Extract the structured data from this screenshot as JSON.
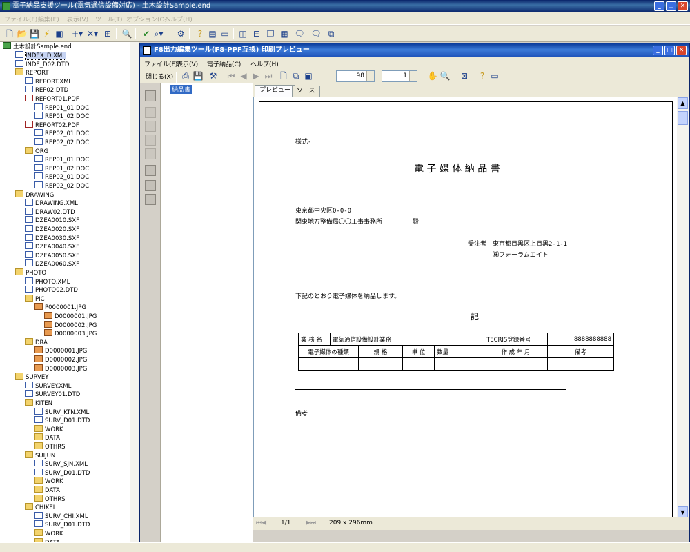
{
  "app": {
    "title": "電子納品支援ツール(電気通信設備対応) - 土木設計Sample.end",
    "menu": [
      "ファイル(F)",
      "編集(E)",
      "表示(V)",
      "ツール(T)",
      "オプション(O)",
      "ヘルプ(H)"
    ]
  },
  "tree": {
    "root": "土木設計Sample.end",
    "nodes": [
      {
        "label": "INDEX_D.XML",
        "type": "file",
        "level": 1,
        "selected": true
      },
      {
        "label": "INDE_D02.DTD",
        "type": "file",
        "level": 1
      },
      {
        "label": "REPORT",
        "type": "folder",
        "level": 1
      },
      {
        "label": "REPORT.XML",
        "type": "file",
        "level": 2
      },
      {
        "label": "REP02.DTD",
        "type": "file",
        "level": 2
      },
      {
        "label": "REPORT01.PDF",
        "type": "pdf",
        "level": 2
      },
      {
        "label": "REP01_01.DOC",
        "type": "file",
        "level": 3
      },
      {
        "label": "REP01_02.DOC",
        "type": "file",
        "level": 3
      },
      {
        "label": "REPORT02.PDF",
        "type": "pdf",
        "level": 2
      },
      {
        "label": "REP02_01.DOC",
        "type": "file",
        "level": 3
      },
      {
        "label": "REP02_02.DOC",
        "type": "file",
        "level": 3
      },
      {
        "label": "ORG",
        "type": "folder",
        "level": 2
      },
      {
        "label": "REP01_01.DOC",
        "type": "file",
        "level": 3
      },
      {
        "label": "REP01_02.DOC",
        "type": "file",
        "level": 3
      },
      {
        "label": "REP02_01.DOC",
        "type": "file",
        "level": 3
      },
      {
        "label": "REP02_02.DOC",
        "type": "file",
        "level": 3
      },
      {
        "label": "DRAWING",
        "type": "folder",
        "level": 1
      },
      {
        "label": "DRAWING.XML",
        "type": "file",
        "level": 2
      },
      {
        "label": "DRAW02.DTD",
        "type": "file",
        "level": 2
      },
      {
        "label": "DZEA0010.SXF",
        "type": "file",
        "level": 2
      },
      {
        "label": "DZEA0020.SXF",
        "type": "file",
        "level": 2
      },
      {
        "label": "DZEA0030.SXF",
        "type": "file",
        "level": 2
      },
      {
        "label": "DZEA0040.SXF",
        "type": "file",
        "level": 2
      },
      {
        "label": "DZEA0050.SXF",
        "type": "file",
        "level": 2
      },
      {
        "label": "DZEA0060.SXF",
        "type": "file",
        "level": 2
      },
      {
        "label": "PHOTO",
        "type": "folder",
        "level": 1
      },
      {
        "label": "PHOTO.XML",
        "type": "file",
        "level": 2
      },
      {
        "label": "PHOTO02.DTD",
        "type": "file",
        "level": 2
      },
      {
        "label": "PIC",
        "type": "folder",
        "level": 2
      },
      {
        "label": "P0000001.JPG",
        "type": "img",
        "level": 3
      },
      {
        "label": "D0000001.JPG",
        "type": "img",
        "level": 4
      },
      {
        "label": "D0000002.JPG",
        "type": "img",
        "level": 4
      },
      {
        "label": "D0000003.JPG",
        "type": "img",
        "level": 4
      },
      {
        "label": "DRA",
        "type": "folder",
        "level": 2
      },
      {
        "label": "D0000001.JPG",
        "type": "img",
        "level": 3
      },
      {
        "label": "D0000002.JPG",
        "type": "img",
        "level": 3
      },
      {
        "label": "D0000003.JPG",
        "type": "img",
        "level": 3
      },
      {
        "label": "SURVEY",
        "type": "folder",
        "level": 1
      },
      {
        "label": "SURVEY.XML",
        "type": "file",
        "level": 2
      },
      {
        "label": "SURVEY01.DTD",
        "type": "file",
        "level": 2
      },
      {
        "label": "KITEN",
        "type": "folder",
        "level": 2
      },
      {
        "label": "SURV_KTN.XML",
        "type": "file",
        "level": 3
      },
      {
        "label": "SURV_D01.DTD",
        "type": "file",
        "level": 3
      },
      {
        "label": "WORK",
        "type": "folder",
        "level": 3
      },
      {
        "label": "DATA",
        "type": "folder",
        "level": 3
      },
      {
        "label": "OTHRS",
        "type": "folder",
        "level": 3
      },
      {
        "label": "SUIJUN",
        "type": "folder",
        "level": 2
      },
      {
        "label": "SURV_SJN.XML",
        "type": "file",
        "level": 3
      },
      {
        "label": "SURV_D01.DTD",
        "type": "file",
        "level": 3
      },
      {
        "label": "WORK",
        "type": "folder",
        "level": 3
      },
      {
        "label": "DATA",
        "type": "folder",
        "level": 3
      },
      {
        "label": "OTHRS",
        "type": "folder",
        "level": 3
      },
      {
        "label": "CHIKEI",
        "type": "folder",
        "level": 2
      },
      {
        "label": "SURV_CHI.XML",
        "type": "file",
        "level": 3
      },
      {
        "label": "SURV_D01.DTD",
        "type": "file",
        "level": 3
      },
      {
        "label": "WORK",
        "type": "folder",
        "level": 3
      },
      {
        "label": "DATA",
        "type": "folder",
        "level": 3
      }
    ]
  },
  "child": {
    "title": "F8出力編集ツール(F8-PPF互換) 印刷プレビュー",
    "menu": [
      "ファイル(F)",
      "表示(V)",
      "電子納品(C)",
      "ヘルプ(H)"
    ],
    "close_label": "閉じる(X)",
    "zoom_value": "98",
    "page_value": "1",
    "doc_node": "納品書",
    "tabs": [
      "プレビュー",
      "ソース"
    ],
    "status": {
      "page": "1/1",
      "size": "209 x 296mm"
    }
  },
  "document": {
    "style_label": "様式-",
    "title": "電 子 媒 体 納 品 書",
    "address1": "東京都中央区0-0-0",
    "address2": "関東地方整備局〇〇工事事務所",
    "honorific": "殿",
    "contractor_label": "受注者",
    "contractor_address": "東京都目黒区上目黒2-1-1",
    "contractor_name": "㈱フォーラムエイト",
    "statement": "下記のとおり電子媒体を納品します。",
    "ki": "記",
    "table": {
      "row1": [
        "業 務 名",
        "電気通信設備設計業務",
        "TECRIS登録番号",
        "8888888888"
      ],
      "row2": [
        "電子媒体の種類",
        "規 格",
        "単 位",
        "数量",
        "作 成 年 月",
        "備考"
      ]
    },
    "remarks": "備考"
  }
}
